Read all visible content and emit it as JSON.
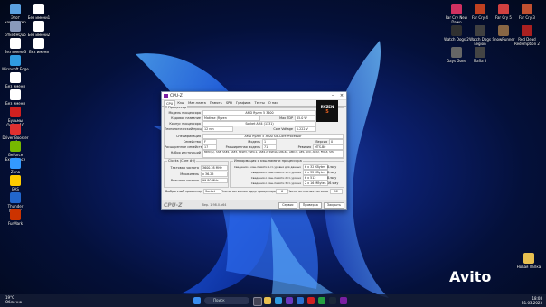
{
  "desktop": {
    "left_icons": [
      {
        "label": "Этот компьютер",
        "color": "#5aa0e0"
      },
      {
        "label": "Без имени1",
        "color": "#ffffff"
      },
      {
        "label": "pYkedHQub",
        "color": "#8899bb"
      },
      {
        "label": "Без имени2",
        "color": "#ffffff"
      },
      {
        "label": "Без имени3",
        "color": "#ffffff"
      },
      {
        "label": "Без имени",
        "color": "#ffffff"
      },
      {
        "label": "Microsoft Edge",
        "color": "#2f9be0"
      },
      {
        "label": "Без имени",
        "color": "#ffffff"
      },
      {
        "label": "Без имени",
        "color": "#ffffff"
      },
      {
        "label": "Бульмы Online 10",
        "color": "#d02020"
      },
      {
        "label": "Driver Booster 10",
        "color": "#e03030"
      },
      {
        "label": "GeForce Experience",
        "color": "#76b900"
      },
      {
        "label": "Zona",
        "color": "#3399ff"
      },
      {
        "label": "EAS",
        "color": "#ffcc00"
      },
      {
        "label": "Thunder Master",
        "color": "#2266cc"
      },
      {
        "label": "FurMark",
        "color": "#cc3300"
      }
    ],
    "right_icons": [
      {
        "label": "Far Cry New Dawn",
        "color": "#d03060"
      },
      {
        "label": "Far Cry 4",
        "color": "#c04020"
      },
      {
        "label": "Far Cry 5",
        "color": "#d04040"
      },
      {
        "label": "Far Cry 3",
        "color": "#c05030"
      },
      {
        "label": "Watch Dogs 2",
        "color": "#303030"
      },
      {
        "label": "Watch Dogs Legion",
        "color": "#404040"
      },
      {
        "label": "SnowRunner",
        "color": "#886644"
      },
      {
        "label": "Red Dead Redemption 2",
        "color": "#aa2020"
      },
      {
        "label": "Days Gone",
        "color": "#666666"
      },
      {
        "label": "Mafia II",
        "color": "#444444"
      },
      {
        "label": "Новая папка",
        "color": "#e8c050"
      }
    ]
  },
  "cpuz": {
    "title": "CPU-Z",
    "tabs": [
      "CPU",
      "Кэш",
      "Мат.плата",
      "Память",
      "SPD",
      "Графика",
      "Тесты",
      "О нас"
    ],
    "processor_group": "Процессор",
    "name_label": "Модель процессора",
    "name_value": "AMD Ryzen 5 3600",
    "codename_label": "Кодовое название",
    "codename_value": "Matisse (Ryzen",
    "maxtdp_label": "Max TDP",
    "maxtdp_value": "65.0 W",
    "package_label": "Корпус процессора",
    "package_value": "Socket AM4 (1331)",
    "tech_label": "Технологический процесс",
    "tech_value": "12 nm",
    "voltage_label": "Core Voltage",
    "voltage_value": "1.222 V",
    "spec_label": "Спецификация",
    "spec_value": "AMD Ryzen 5 3600 Six-Core Processor",
    "family_label": "Семейство",
    "family_value": "F",
    "model_label": "Модель",
    "model_value": "1",
    "stepping_label": "Версия",
    "stepping_value": "0",
    "ext_family_label": "Расширенное семейство",
    "ext_family_value": "17",
    "ext_model_label": "Расширенная модель",
    "ext_model_value": "71",
    "revision_label": "Ревизия",
    "revision_value": "MTS-B0",
    "instr_label": "Набор инструкций",
    "instr_value": "MMX(+), SSE, SSE2, SSE3, SSSE3, SSE4.1, SSE4.2, SSE4A, x86-64, AMD-V, AES, AVX, AVX2, FMA3, SHA",
    "clocks_group": "Clocks (Core #0)",
    "core_speed_label": "Тактовая частота",
    "core_speed_value": "3600.28 MHz",
    "multiplier_label": "Множитель",
    "multiplier_value": "x 36.25",
    "bus_label": "Внешняя частота",
    "bus_value": "99.80 MHz",
    "cache_group": "Информация о кэш-памяти процессора",
    "l1d_label": "Сведения о кэш-памяти 1-го уровня для данных",
    "l1d_value": "6 x 32 KBytes",
    "l1d_way": "8-way",
    "l1i_label": "Сведения о кэш-памяти 1-го уровня",
    "l1i_value": "6 x 32 KBytes",
    "l1i_way": "8-way",
    "l2_label": "Сведения о кэш-памяти 2-го уровня",
    "l2_value": "6 x 512 KBytes",
    "l2_way": "8-way",
    "l3_label": "Сведения о кэш-памяти 3-го уровня",
    "l3_value": "2 x 16 MBytes",
    "l3_way": "16-way",
    "selection_label": "Выбранный процессор",
    "selection_value": "Socket #1",
    "cores_label": "Число активных ядер процессора",
    "cores_value": "6",
    "threads_label": "Число активных потоков",
    "threads_value": "12",
    "version": "Вер. 1.98.0.x64",
    "tools_btn": "Сервис",
    "validate_btn": "Проверка",
    "close_btn": "Закрыть",
    "logo_text": "RYZEN",
    "logo_sub": "5"
  },
  "taskbar": {
    "weather_temp": "19°C",
    "weather_desc": "Облачно",
    "search_placeholder": "Поиск",
    "time": "18:08",
    "date": "31.03.2023"
  },
  "watermark": "Avito"
}
